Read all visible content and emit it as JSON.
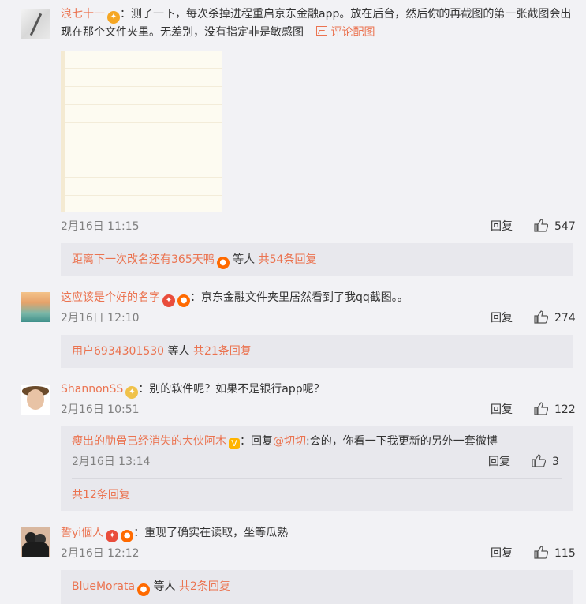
{
  "comments": [
    {
      "username": "浪七十一",
      "colon": "：",
      "text": "测了一下，每次杀掉进程重启京东金融app。放在后台，然后你的再截图的第一张截图会出现在那个文件夹里。无差别，没有指定非是敏感图",
      "pic_link": "评论配图",
      "time": "2月16日 11:15",
      "reply_label": "回复",
      "likes": "547",
      "summary": {
        "user": "距离下一次改名还有365天鸭",
        "mid": " 等人 ",
        "count": "共54条回复"
      }
    },
    {
      "username": "这应该是个好的名字",
      "colon": "：",
      "text": "京东金融文件夹里居然看到了我qq截图。。",
      "time": "2月16日 12:10",
      "reply_label": "回复",
      "likes": "274",
      "summary": {
        "user": "用户6934301530",
        "mid": " 等人 ",
        "count": "共21条回复"
      }
    },
    {
      "username": "ShannonSS",
      "colon": "：",
      "text": "别的软件呢？如果不是银行app呢？",
      "time": "2月16日 10:51",
      "reply_label": "回复",
      "likes": "122",
      "sub_reply": {
        "username": "瘦出的肋骨已经消失的大侠阿木",
        "colon": "：",
        "prefix": "回复",
        "mention": "@切切",
        "text": ":会的，你看一下我更新的另外一套微博",
        "time": "2月16日 13:14",
        "reply_label": "回复",
        "likes": "3"
      },
      "total": "共12条回复"
    },
    {
      "username": "誓yi個人",
      "colon": "：",
      "text": "重现了确实在读取，坐等瓜熟",
      "time": "2月16日 12:12",
      "reply_label": "回复",
      "likes": "115",
      "summary": {
        "user": "BlueMorata",
        "mid": " 等人 ",
        "count": "共2条回复"
      }
    }
  ],
  "colors": {
    "accent": "#eb7350",
    "background": "#f2f2f5",
    "subbox": "#e8e8ed",
    "meta": "#808080"
  },
  "icons": [
    "thumbs-up-icon",
    "picture-icon",
    "medal-badge-icon",
    "verified-v-icon"
  ]
}
